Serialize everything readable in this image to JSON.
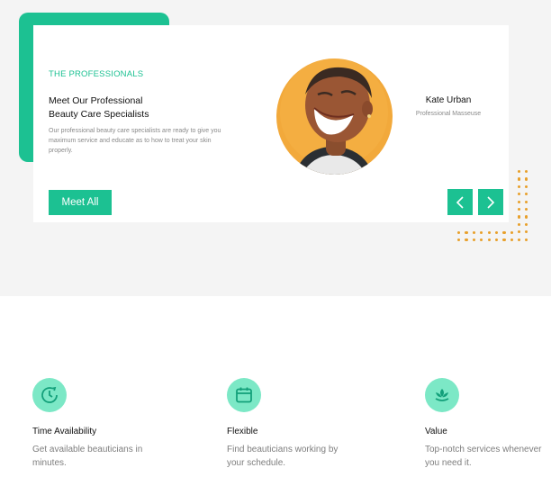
{
  "professionals": {
    "eyebrow": "THE PROFESSIONALS",
    "title_line1": "Meet Our Professional",
    "title_line2": "Beauty Care Specialists",
    "description": "Our professional beauty care specialists are ready to give you maximum service and educate as to how to treat your skin properly.",
    "meet_all_label": "Meet All",
    "specialist": {
      "name": "Kate Urban",
      "role": "Professional Masseuse"
    },
    "prev_icon": "chevron-left-icon",
    "next_icon": "chevron-right-icon"
  },
  "features": [
    {
      "icon": "clock-icon",
      "title": "Time Availability",
      "description": "Get available beauticians in minutes."
    },
    {
      "icon": "calendar-icon",
      "title": "Flexible",
      "description": "Find beauticians working by your schedule."
    },
    {
      "icon": "leaf-icon",
      "title": "Value",
      "description": "Top-notch services whenever you need it."
    }
  ],
  "colors": {
    "accent": "#1cc192",
    "accent_light": "#7ce8c6",
    "dots": "#e8a02b",
    "section_bg": "#f4f4f4"
  }
}
